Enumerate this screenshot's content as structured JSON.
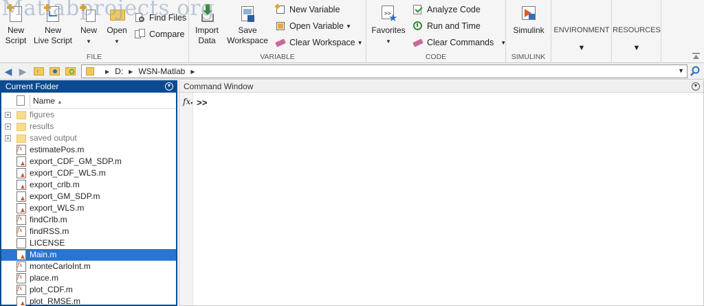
{
  "watermark": "Matlabprojects.org",
  "ribbon": {
    "file": {
      "label": "FILE",
      "new_script": "New\nScript",
      "new_live_script": "New\nLive Script",
      "new": "New",
      "open": "Open",
      "find_files": "Find Files",
      "compare": "Compare"
    },
    "variable": {
      "label": "VARIABLE",
      "import_data": "Import\nData",
      "save_workspace": "Save\nWorkspace",
      "new_variable": "New Variable",
      "open_variable": "Open Variable",
      "clear_workspace": "Clear Workspace"
    },
    "code": {
      "label": "CODE",
      "favorites": "Favorites",
      "analyze_code": "Analyze Code",
      "run_and_time": "Run and Time",
      "clear_commands": "Clear Commands"
    },
    "simulink": {
      "label": "SIMULINK",
      "simulink": "Simulink"
    },
    "environment": "ENVIRONMENT",
    "resources": "RESOURCES"
  },
  "address": {
    "crumbs": [
      "D:",
      "WSN-Matlab"
    ]
  },
  "current_folder": {
    "title": "Current Folder",
    "column_name": "Name",
    "items": [
      {
        "name": "figures",
        "type": "folder"
      },
      {
        "name": "results",
        "type": "folder"
      },
      {
        "name": "saved output",
        "type": "folder"
      },
      {
        "name": "estimatePos.m",
        "type": "fx"
      },
      {
        "name": "export_CDF_GM_SDP.m",
        "type": "m"
      },
      {
        "name": "export_CDF_WLS.m",
        "type": "m"
      },
      {
        "name": "export_crlb.m",
        "type": "m"
      },
      {
        "name": "export_GM_SDP.m",
        "type": "m"
      },
      {
        "name": "export_WLS.m",
        "type": "m"
      },
      {
        "name": "findCrlb.m",
        "type": "fx"
      },
      {
        "name": "findRSS.m",
        "type": "fx"
      },
      {
        "name": "LICENSE",
        "type": "plain"
      },
      {
        "name": "Main.m",
        "type": "m",
        "selected": true
      },
      {
        "name": "monteCarloInt.m",
        "type": "fx"
      },
      {
        "name": "place.m",
        "type": "fx"
      },
      {
        "name": "plot_CDF.m",
        "type": "fx"
      },
      {
        "name": "plot_RMSE.m",
        "type": "m"
      }
    ]
  },
  "command_window": {
    "title": "Command Window",
    "prompt": ">>"
  }
}
